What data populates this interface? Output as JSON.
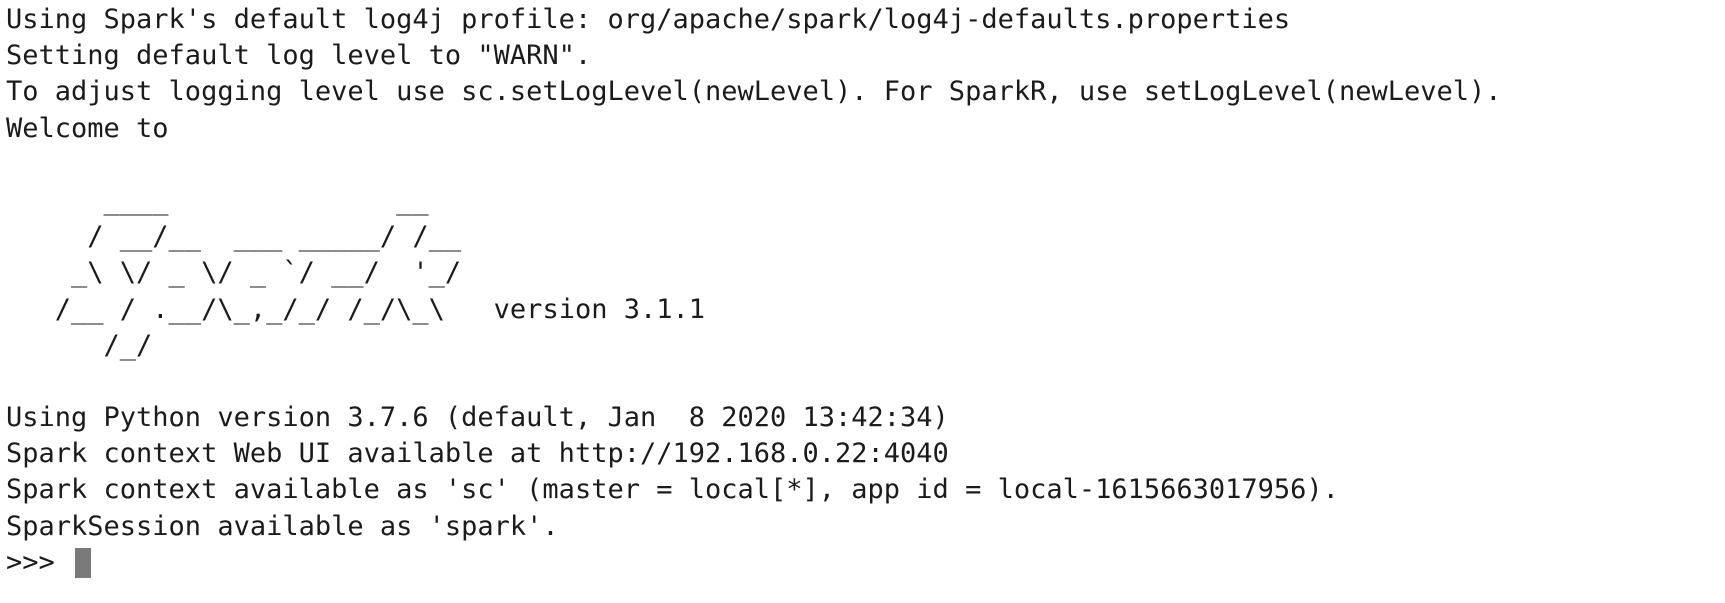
{
  "terminal": {
    "startup_lines": [
      "Using Spark's default log4j profile: org/apache/spark/log4j-defaults.properties",
      "Setting default log level to \"WARN\".",
      "To adjust logging level use sc.setLogLevel(newLevel). For SparkR, use setLogLevel(newLevel).",
      "Welcome to"
    ],
    "banner": [
      "      ____              __",
      "     / __/__  ___ _____/ /__",
      "    _\\ \\/ _ \\/ _ `/ __/  '_/",
      "   /__ / .__/\\_,_/_/ /_/\\_\\   ",
      "      /_/"
    ],
    "version_label": "version 3.1.1",
    "info_lines": [
      "Using Python version 3.7.6 (default, Jan  8 2020 13:42:34)",
      "Spark context Web UI available at http://192.168.0.22:4040",
      "Spark context available as 'sc' (master = local[*], app id = local-1615663017956).",
      "SparkSession available as 'spark'."
    ],
    "prompt": ">>> "
  }
}
